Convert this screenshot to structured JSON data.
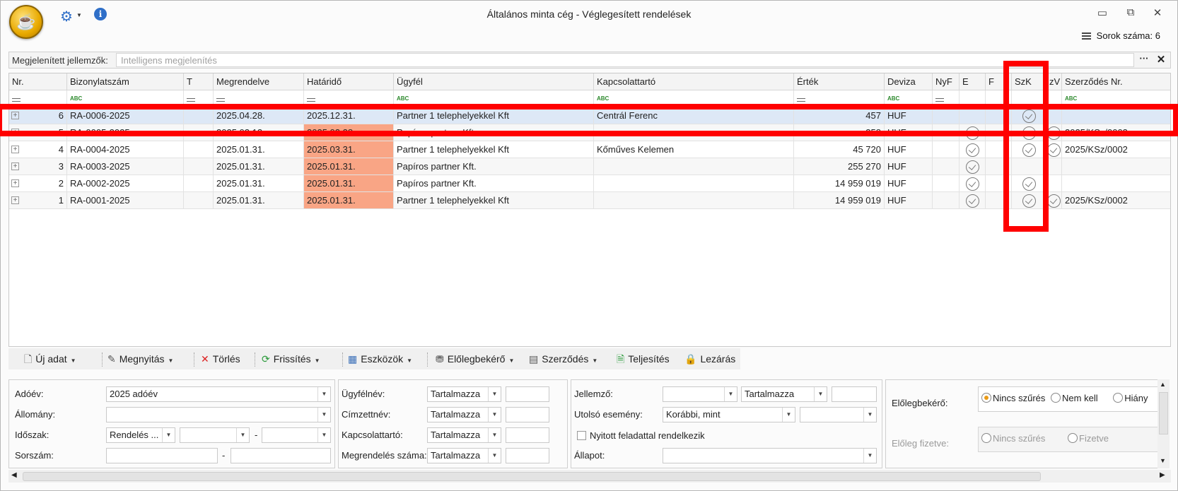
{
  "window": {
    "title": "Általános minta cég - Véglegesített rendelések",
    "logo_glyph": "☕",
    "rows_label": "Sorok száma: 6",
    "controls": {
      "minimize": "▭",
      "restore": "⧉",
      "close": "✕"
    }
  },
  "attributes": {
    "label": "Megjelenített jellemzők:",
    "placeholder": "Intelligens megjelenítés",
    "more": "···",
    "clear": "✕"
  },
  "table": {
    "columns": [
      "Nr.",
      "Bizonylatszám",
      "T",
      "Megrendelve",
      "Határidő",
      "Ügyfél",
      "Kapcsolattartó",
      "Érték",
      "Deviza",
      "NyF",
      "E",
      "F",
      "SzK",
      "zV",
      "Szerződés Nr."
    ],
    "rows": [
      {
        "nr": "6",
        "doc": "RA-0006-2025",
        "t": "",
        "ordered": "2025.04.28.",
        "deadline": "2025.12.31.",
        "customer": "Partner 1 telephelyekkel Kft",
        "contact": "Centrál Ferenc",
        "value": "457",
        "currency": "HUF",
        "nyf": "",
        "e": false,
        "f": false,
        "szk": true,
        "zv": false,
        "contract": "",
        "overdue": false,
        "selected": true
      },
      {
        "nr": "5",
        "doc": "RA-0005-2025",
        "t": "",
        "ordered": "2025.02.12.",
        "deadline": "2025.02.28.",
        "customer": "Papíros partner Kft.",
        "contact": "",
        "value": "358",
        "currency": "HUF",
        "nyf": "",
        "e": true,
        "f": false,
        "szk": true,
        "zv": true,
        "contract": "2025/KSz/0003",
        "overdue": true,
        "selected": false
      },
      {
        "nr": "4",
        "doc": "RA-0004-2025",
        "t": "",
        "ordered": "2025.01.31.",
        "deadline": "2025.03.31.",
        "customer": "Partner 1 telephelyekkel Kft",
        "contact": "Kőműves Kelemen",
        "value": "45 720",
        "currency": "HUF",
        "nyf": "",
        "e": true,
        "f": false,
        "szk": true,
        "zv": true,
        "contract": "2025/KSz/0002",
        "overdue": true,
        "selected": false
      },
      {
        "nr": "3",
        "doc": "RA-0003-2025",
        "t": "",
        "ordered": "2025.01.31.",
        "deadline": "2025.01.31.",
        "customer": "Papíros partner Kft.",
        "contact": "",
        "value": "255 270",
        "currency": "HUF",
        "nyf": "",
        "e": true,
        "f": false,
        "szk": false,
        "zv": false,
        "contract": "",
        "overdue": true,
        "selected": false
      },
      {
        "nr": "2",
        "doc": "RA-0002-2025",
        "t": "",
        "ordered": "2025.01.31.",
        "deadline": "2025.01.31.",
        "customer": "Papíros partner Kft.",
        "contact": "",
        "value": "14 959 019",
        "currency": "HUF",
        "nyf": "",
        "e": true,
        "f": false,
        "szk": true,
        "zv": false,
        "contract": "",
        "overdue": true,
        "selected": false
      },
      {
        "nr": "1",
        "doc": "RA-0001-2025",
        "t": "",
        "ordered": "2025.01.31.",
        "deadline": "2025.01.31.",
        "customer": "Partner 1 telephelyekkel Kft",
        "contact": "",
        "value": "14 959 019",
        "currency": "HUF",
        "nyf": "",
        "e": true,
        "f": false,
        "szk": true,
        "zv": true,
        "contract": "2025/KSz/0002",
        "overdue": true,
        "selected": false
      }
    ]
  },
  "toolbar": {
    "new": "Új adat",
    "open": "Megnyitás",
    "delete": "Törlés",
    "refresh": "Frissítés",
    "tools": "Eszközök",
    "advance": "Előlegbekérő",
    "contract": "Szerződés",
    "fulfill": "Teljesítés",
    "close": "Lezárás"
  },
  "filters": {
    "year_label": "Adóév:",
    "year_value": "2025 adóév",
    "stock_label": "Állomány:",
    "period_label": "Időszak:",
    "period_value": "Rendelés ...",
    "period_dash": "-",
    "serial_label": "Sorszám:",
    "serial_dash": "-",
    "customer_label": "Ügyfélnév:",
    "addressee_label": "Címzettnév:",
    "contact_label": "Kapcsolattartó:",
    "order_no_label": "Megrendelés száma:",
    "contains": "Tartalmazza",
    "attr_label": "Jellemző:",
    "last_event_label": "Utolsó esemény:",
    "last_event_value": "Korábbi, mint",
    "open_task_label": "Nyitott feladattal rendelkezik",
    "status_label": "Állapot:",
    "advance_req_label": "Előlegbekérő:",
    "advance_paid_label": "Előleg fizetve:",
    "radio_no_filter": "Nincs szűrés",
    "radio_not_needed": "Nem kell",
    "radio_missing": "Hiány",
    "radio_paid": "Fizetve"
  }
}
